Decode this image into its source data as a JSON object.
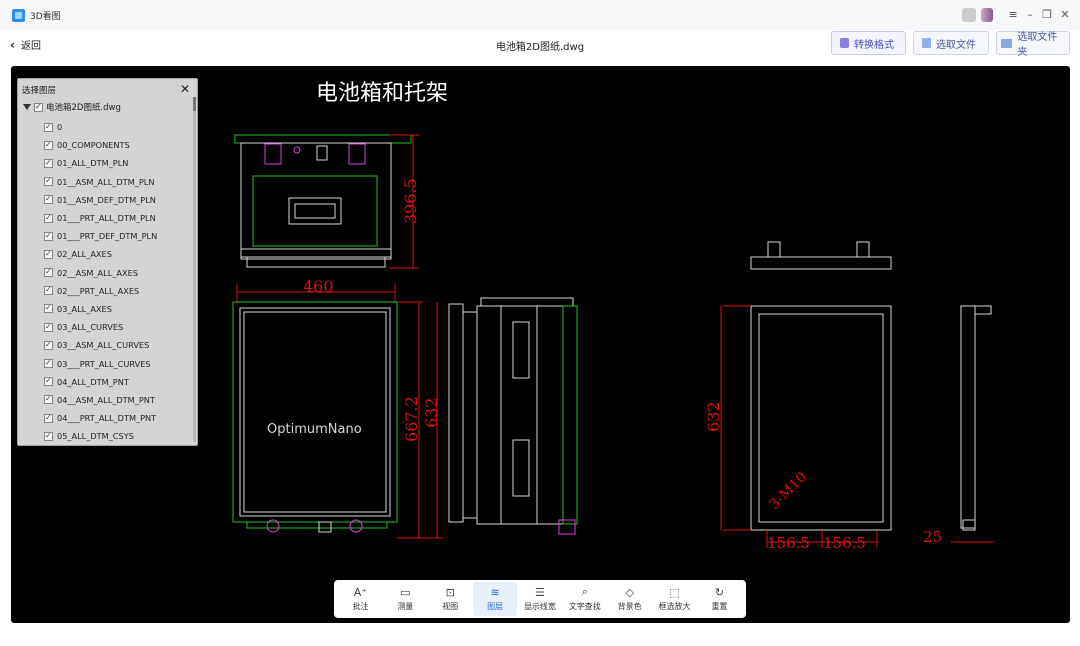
{
  "app": {
    "title": "3D看图"
  },
  "header": {
    "back_label": "返回",
    "file_name": "电池箱2D图纸.dwg",
    "buttons": [
      {
        "label": "转换格式",
        "icon": "convert-icon"
      },
      {
        "label": "选取文件",
        "icon": "file-icon"
      },
      {
        "label": "选取文件夹",
        "icon": "folder-icon"
      }
    ]
  },
  "layer_panel": {
    "title": "选择图层",
    "root": "电池箱2D图纸.dwg",
    "layers": [
      "0",
      "00_COMPONENTS",
      "01_ALL_DTM_PLN",
      "01__ASM_ALL_DTM_PLN",
      "01__ASM_DEF_DTM_PLN",
      "01___PRT_ALL_DTM_PLN",
      "01___PRT_DEF_DTM_PLN",
      "02_ALL_AXES",
      "02__ASM_ALL_AXES",
      "02___PRT_ALL_AXES",
      "03_ALL_AXES",
      "03_ALL_CURVES",
      "03__ASM_ALL_CURVES",
      "03___PRT_ALL_CURVES",
      "04_ALL_DTM_PNT",
      "04__ASM_ALL_DTM_PNT",
      "04___PRT_ALL_DTM_PNT",
      "05_ALL_DTM_CSYS"
    ]
  },
  "drawing": {
    "title": "电池箱和托架",
    "brand": "OptimumNano",
    "dims": {
      "d1": "396.5",
      "d2": "460",
      "d3": "667.2",
      "d4": "632",
      "d5": "632",
      "d6": "3-M10",
      "d7": "156.5",
      "d8": "156.5",
      "d9": "25"
    },
    "colors": {
      "dim": "#e01010",
      "outline": "#20c020",
      "part": "#d8d8d8",
      "magenta": "#e040e0"
    }
  },
  "bottom_toolbar": [
    {
      "label": "批注",
      "icon": "annotate-icon",
      "glyph": "A⁺"
    },
    {
      "label": "测量",
      "icon": "measure-icon",
      "glyph": "▭"
    },
    {
      "label": "视图",
      "icon": "view-icon",
      "glyph": "⊡"
    },
    {
      "label": "图层",
      "icon": "layers-icon",
      "glyph": "≋",
      "active": true
    },
    {
      "label": "显示线宽",
      "icon": "line-width-icon",
      "glyph": "☰"
    },
    {
      "label": "文字查找",
      "icon": "text-search-icon",
      "glyph": "⌕"
    },
    {
      "label": "背景色",
      "icon": "bg-color-icon",
      "glyph": "◇"
    },
    {
      "label": "框选放大",
      "icon": "zoom-box-icon",
      "glyph": "⬚"
    },
    {
      "label": "重置",
      "icon": "reset-icon",
      "glyph": "↻"
    }
  ]
}
